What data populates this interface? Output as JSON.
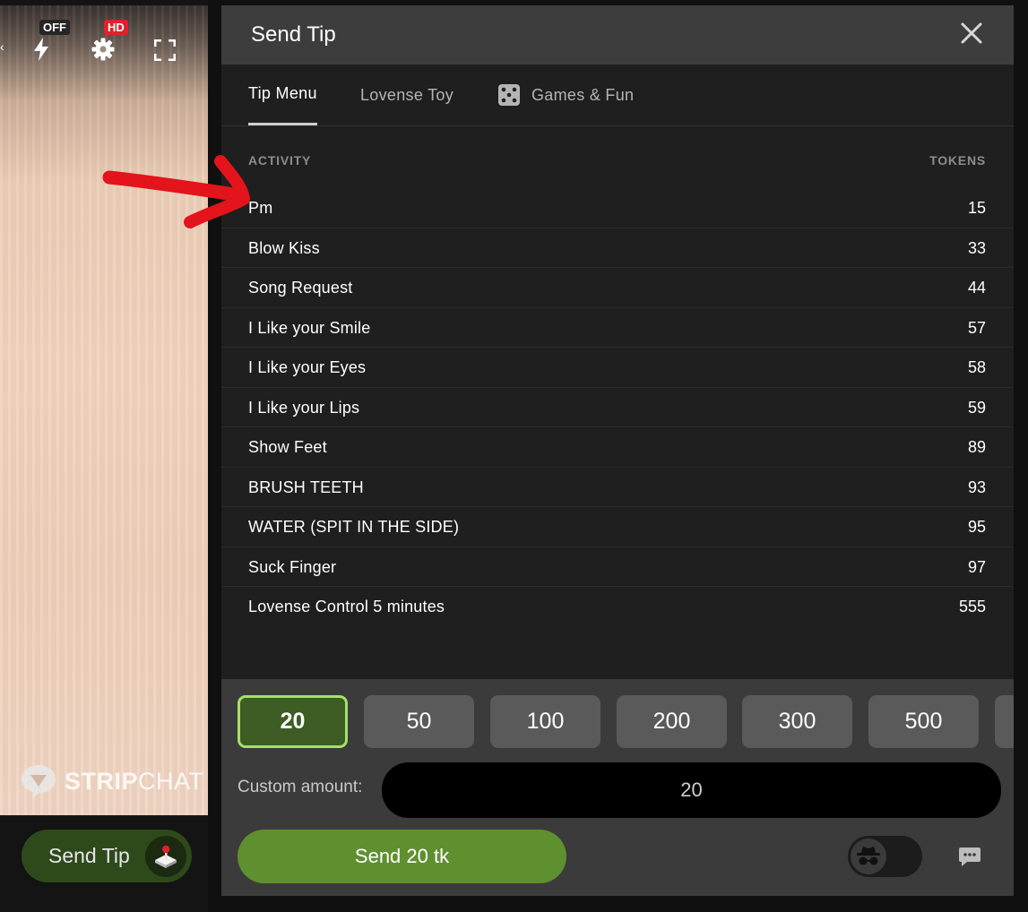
{
  "video": {
    "badge_off": "OFF",
    "badge_hd": "HD",
    "brand_bold": "STRIP",
    "brand_thin": "CHAT",
    "send_tip_label": "Send Tip",
    "icons": [
      "back-arrow-icon",
      "lightning-icon",
      "gear-icon",
      "fullscreen-icon",
      "stripchat-logo-icon",
      "joystick-icon"
    ]
  },
  "dialog": {
    "title": "Send Tip",
    "tabs": [
      {
        "label": "Tip Menu",
        "active": true
      },
      {
        "label": "Lovense Toy",
        "active": false
      },
      {
        "label": "Games & Fun",
        "active": false
      }
    ],
    "headers": {
      "activity": "ACTIVITY",
      "tokens": "TOKENS"
    },
    "items": [
      {
        "name": "Pm",
        "tokens": "15"
      },
      {
        "name": "Blow Kiss",
        "tokens": "33"
      },
      {
        "name": "Song Request",
        "tokens": "44"
      },
      {
        "name": "I Like your Smile",
        "tokens": "57"
      },
      {
        "name": "I Like your Eyes",
        "tokens": "58"
      },
      {
        "name": "I Like your Lips",
        "tokens": "59"
      },
      {
        "name": "Show Feet",
        "tokens": "89"
      },
      {
        "name": "BRUSH TEETH",
        "tokens": "93"
      },
      {
        "name": "WATER (SPIT IN THE SIDE)",
        "tokens": "95"
      },
      {
        "name": "Suck Finger",
        "tokens": "97"
      },
      {
        "name": "Lovense Control 5 minutes",
        "tokens": "555"
      }
    ],
    "amounts": [
      "20",
      "50",
      "100",
      "200",
      "300",
      "500"
    ],
    "selected_amount": "20",
    "custom_label": "Custom amount:",
    "custom_value": "20",
    "send_label": "Send 20 tk"
  },
  "colors": {
    "accent_green": "#5f9030",
    "selected_border": "#a7e06a",
    "hd_red": "#e0202b",
    "annotation_red": "#e3141b"
  }
}
